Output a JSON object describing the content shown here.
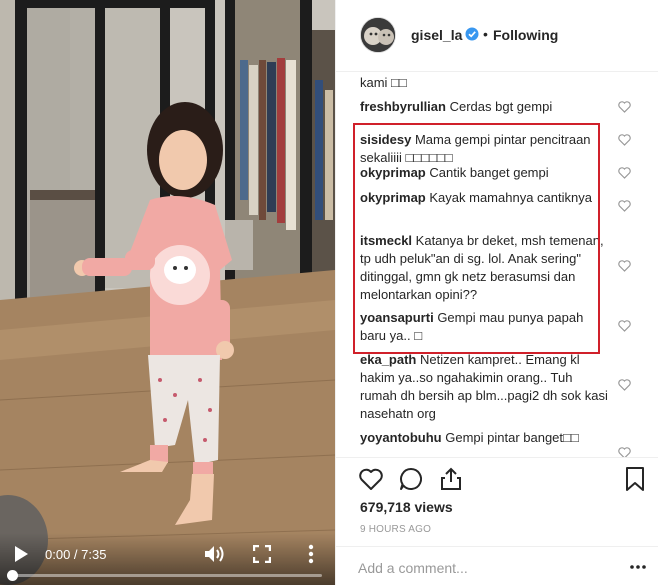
{
  "video": {
    "time_display": "0:00 / 7:35",
    "progress": 0.0,
    "play_icon": "play-icon",
    "volume_icon": "volume-icon",
    "fullscreen_icon": "fullscreen-icon",
    "more_icon": "more-vertical-icon"
  },
  "header": {
    "username": "gisel_la",
    "separator": "•",
    "follow_status": "Following",
    "verified_icon": "verified-badge-icon"
  },
  "comments": [
    {
      "user": "",
      "text": "kami □□"
    },
    {
      "user": "freshbyrullian",
      "text": "Cerdas bgt gempi"
    },
    {
      "user": "sisidesy",
      "text": "Mama gempi pintar pencitraan sekaliiii □□□□□□"
    },
    {
      "user": "okyprimap",
      "text": "Cantik banget gempi"
    },
    {
      "user": "okyprimap",
      "text": "Kayak mamahnya cantiknya"
    },
    {
      "user": "itsmeckl",
      "text": "Katanya br deket, msh temenan, tp udh peluk\"an di sg. lol. Anak sering\" ditinggal, gmn gk netz berasumsi dan melontarkan opini??"
    },
    {
      "user": "yoansapurti",
      "text": "Gempi mau punya papah baru ya.. □"
    },
    {
      "user": "eka_path",
      "text": "Netizen kampret.. Emang kl hakim ya..so ngahakimin orang.. Tuh rumah dh bersih ap blm...pagi2 dh sok kasi nasehatn org"
    },
    {
      "user": "yoyantobuhu",
      "text": "Gempi pintar banget□□"
    }
  ],
  "actions": {
    "like_icon": "heart-icon",
    "comment_icon": "comment-icon",
    "share_icon": "share-icon",
    "save_icon": "bookmark-icon",
    "views": "679,718 views",
    "time_ago": "9 HOURS AGO",
    "add_comment_placeholder": "Add a comment...",
    "more_icon": "more-horizontal-icon"
  },
  "colors": {
    "highlight_border": "#d0202a",
    "verified_blue": "#3897f0",
    "text_primary": "#262626",
    "text_secondary": "#999999"
  }
}
